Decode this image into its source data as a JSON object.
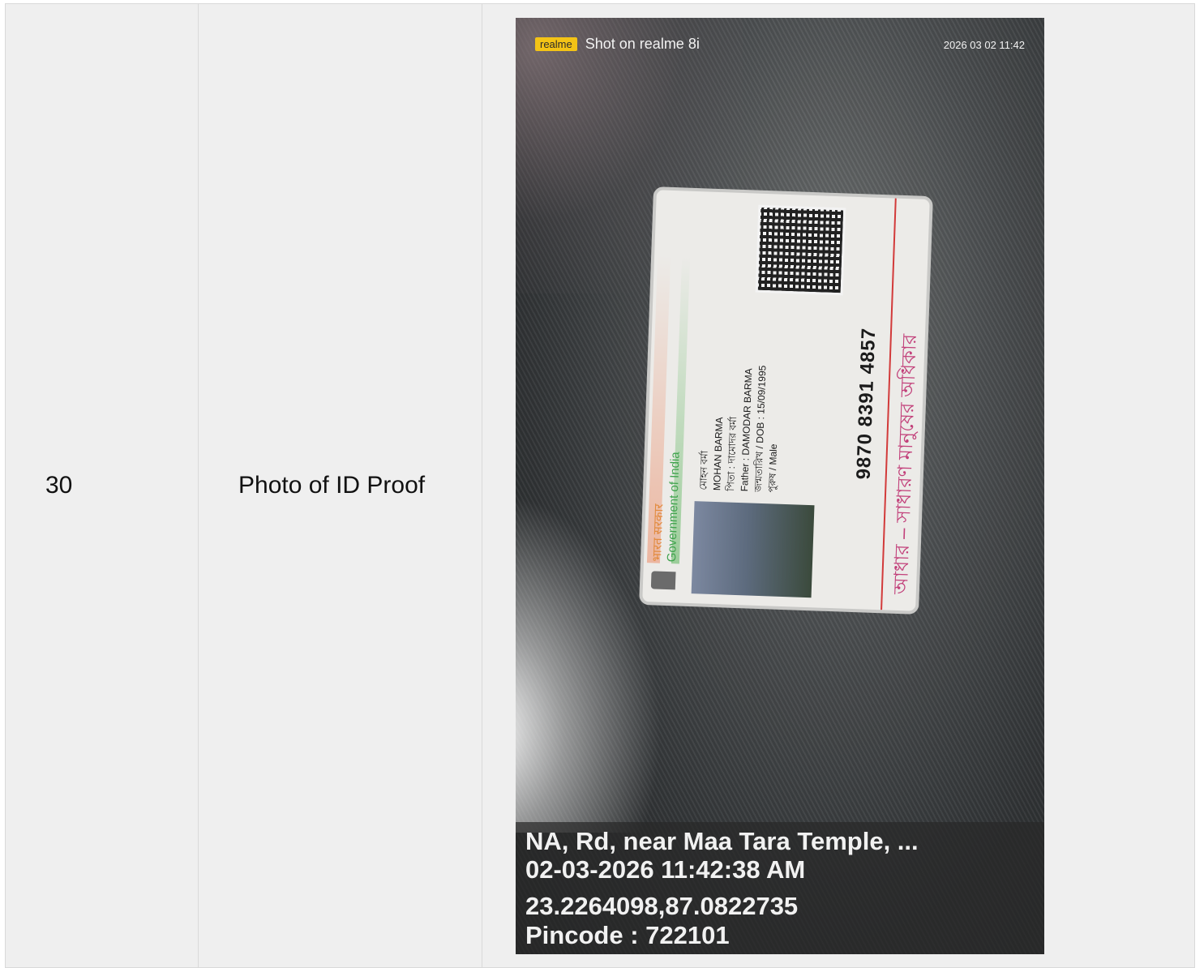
{
  "row": {
    "number": "30",
    "label": "Photo of ID Proof"
  },
  "photo": {
    "watermark": {
      "brand": "realme",
      "text": "Shot on realme 8i",
      "datetime": "2026 03 02 11:42"
    },
    "card": {
      "gov_hindi": "भारत सरकार",
      "gov_english": "Government of India",
      "name_local": "মোহন বর্মা",
      "name": "MOHAN BARMA",
      "father_local": "পিতা : দামোদর বর্মা",
      "father": "Father : DAMODAR BARMA",
      "dob": "জন্মতারিখ / DOB : 15/09/1995",
      "gender": "পুরুষ / Male",
      "number": "9870 8391 4857",
      "tagline": "আধার – সাধারণ মানুষের অধিকার"
    },
    "geo": {
      "address": "NA, Rd, near Maa Tara Temple, ...",
      "datetime": "02-03-2026 11:42:38 AM",
      "coords": "23.2264098,87.0822735",
      "pincode": "Pincode : 722101"
    }
  }
}
